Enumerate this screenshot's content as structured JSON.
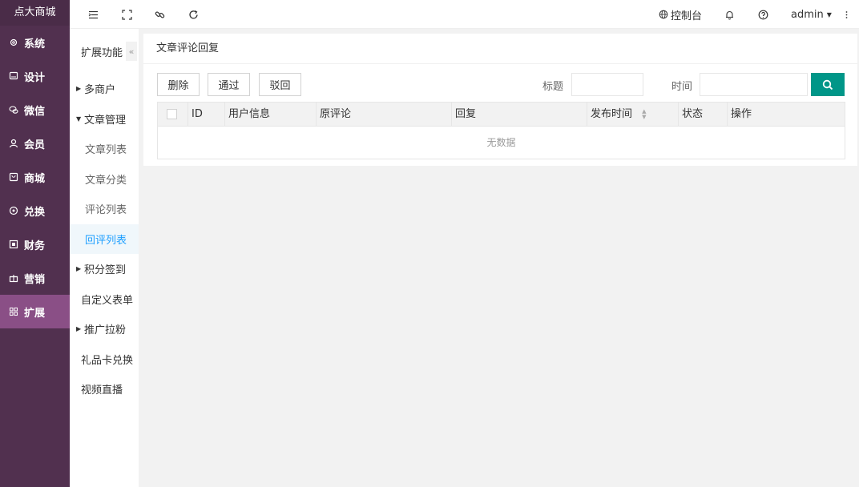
{
  "brand": "点大商城",
  "nav": [
    {
      "label": "系统",
      "icon": "gear-icon"
    },
    {
      "label": "设计",
      "icon": "monitor-icon"
    },
    {
      "label": "微信",
      "icon": "wechat-icon"
    },
    {
      "label": "会员",
      "icon": "user-icon"
    },
    {
      "label": "商城",
      "icon": "shop-icon"
    },
    {
      "label": "兑换",
      "icon": "exchange-icon"
    },
    {
      "label": "财务",
      "icon": "finance-icon"
    },
    {
      "label": "营销",
      "icon": "gift-icon"
    },
    {
      "label": "扩展",
      "icon": "grid-icon"
    }
  ],
  "topbar": {
    "console": "控制台",
    "user": "admin"
  },
  "subnav": {
    "title": "扩展功能",
    "collapse": "«",
    "items": [
      {
        "label": "多商户"
      },
      {
        "label": "文章管理"
      },
      {
        "label": "文章列表"
      },
      {
        "label": "文章分类"
      },
      {
        "label": "评论列表"
      },
      {
        "label": "回评列表"
      },
      {
        "label": "积分签到"
      },
      {
        "label": "自定义表单"
      },
      {
        "label": "推广拉粉"
      },
      {
        "label": "礼品卡兑换"
      },
      {
        "label": "视频直播"
      }
    ]
  },
  "panel": {
    "title": "文章评论回复",
    "buttons": {
      "delete": "删除",
      "approve": "通过",
      "reject": "驳回"
    },
    "filters": {
      "title_label": "标题",
      "time_label": "时间",
      "title_value": "",
      "time_value": ""
    },
    "table": {
      "columns": [
        "ID",
        "用户信息",
        "原评论",
        "回复",
        "发布时间",
        "状态",
        "操作"
      ],
      "empty": "无数据"
    }
  },
  "colors": {
    "sidebar": "#51304f",
    "active_nav": "#8a4f86",
    "search_button": "#009688",
    "active_sub": "#1e9fff"
  }
}
